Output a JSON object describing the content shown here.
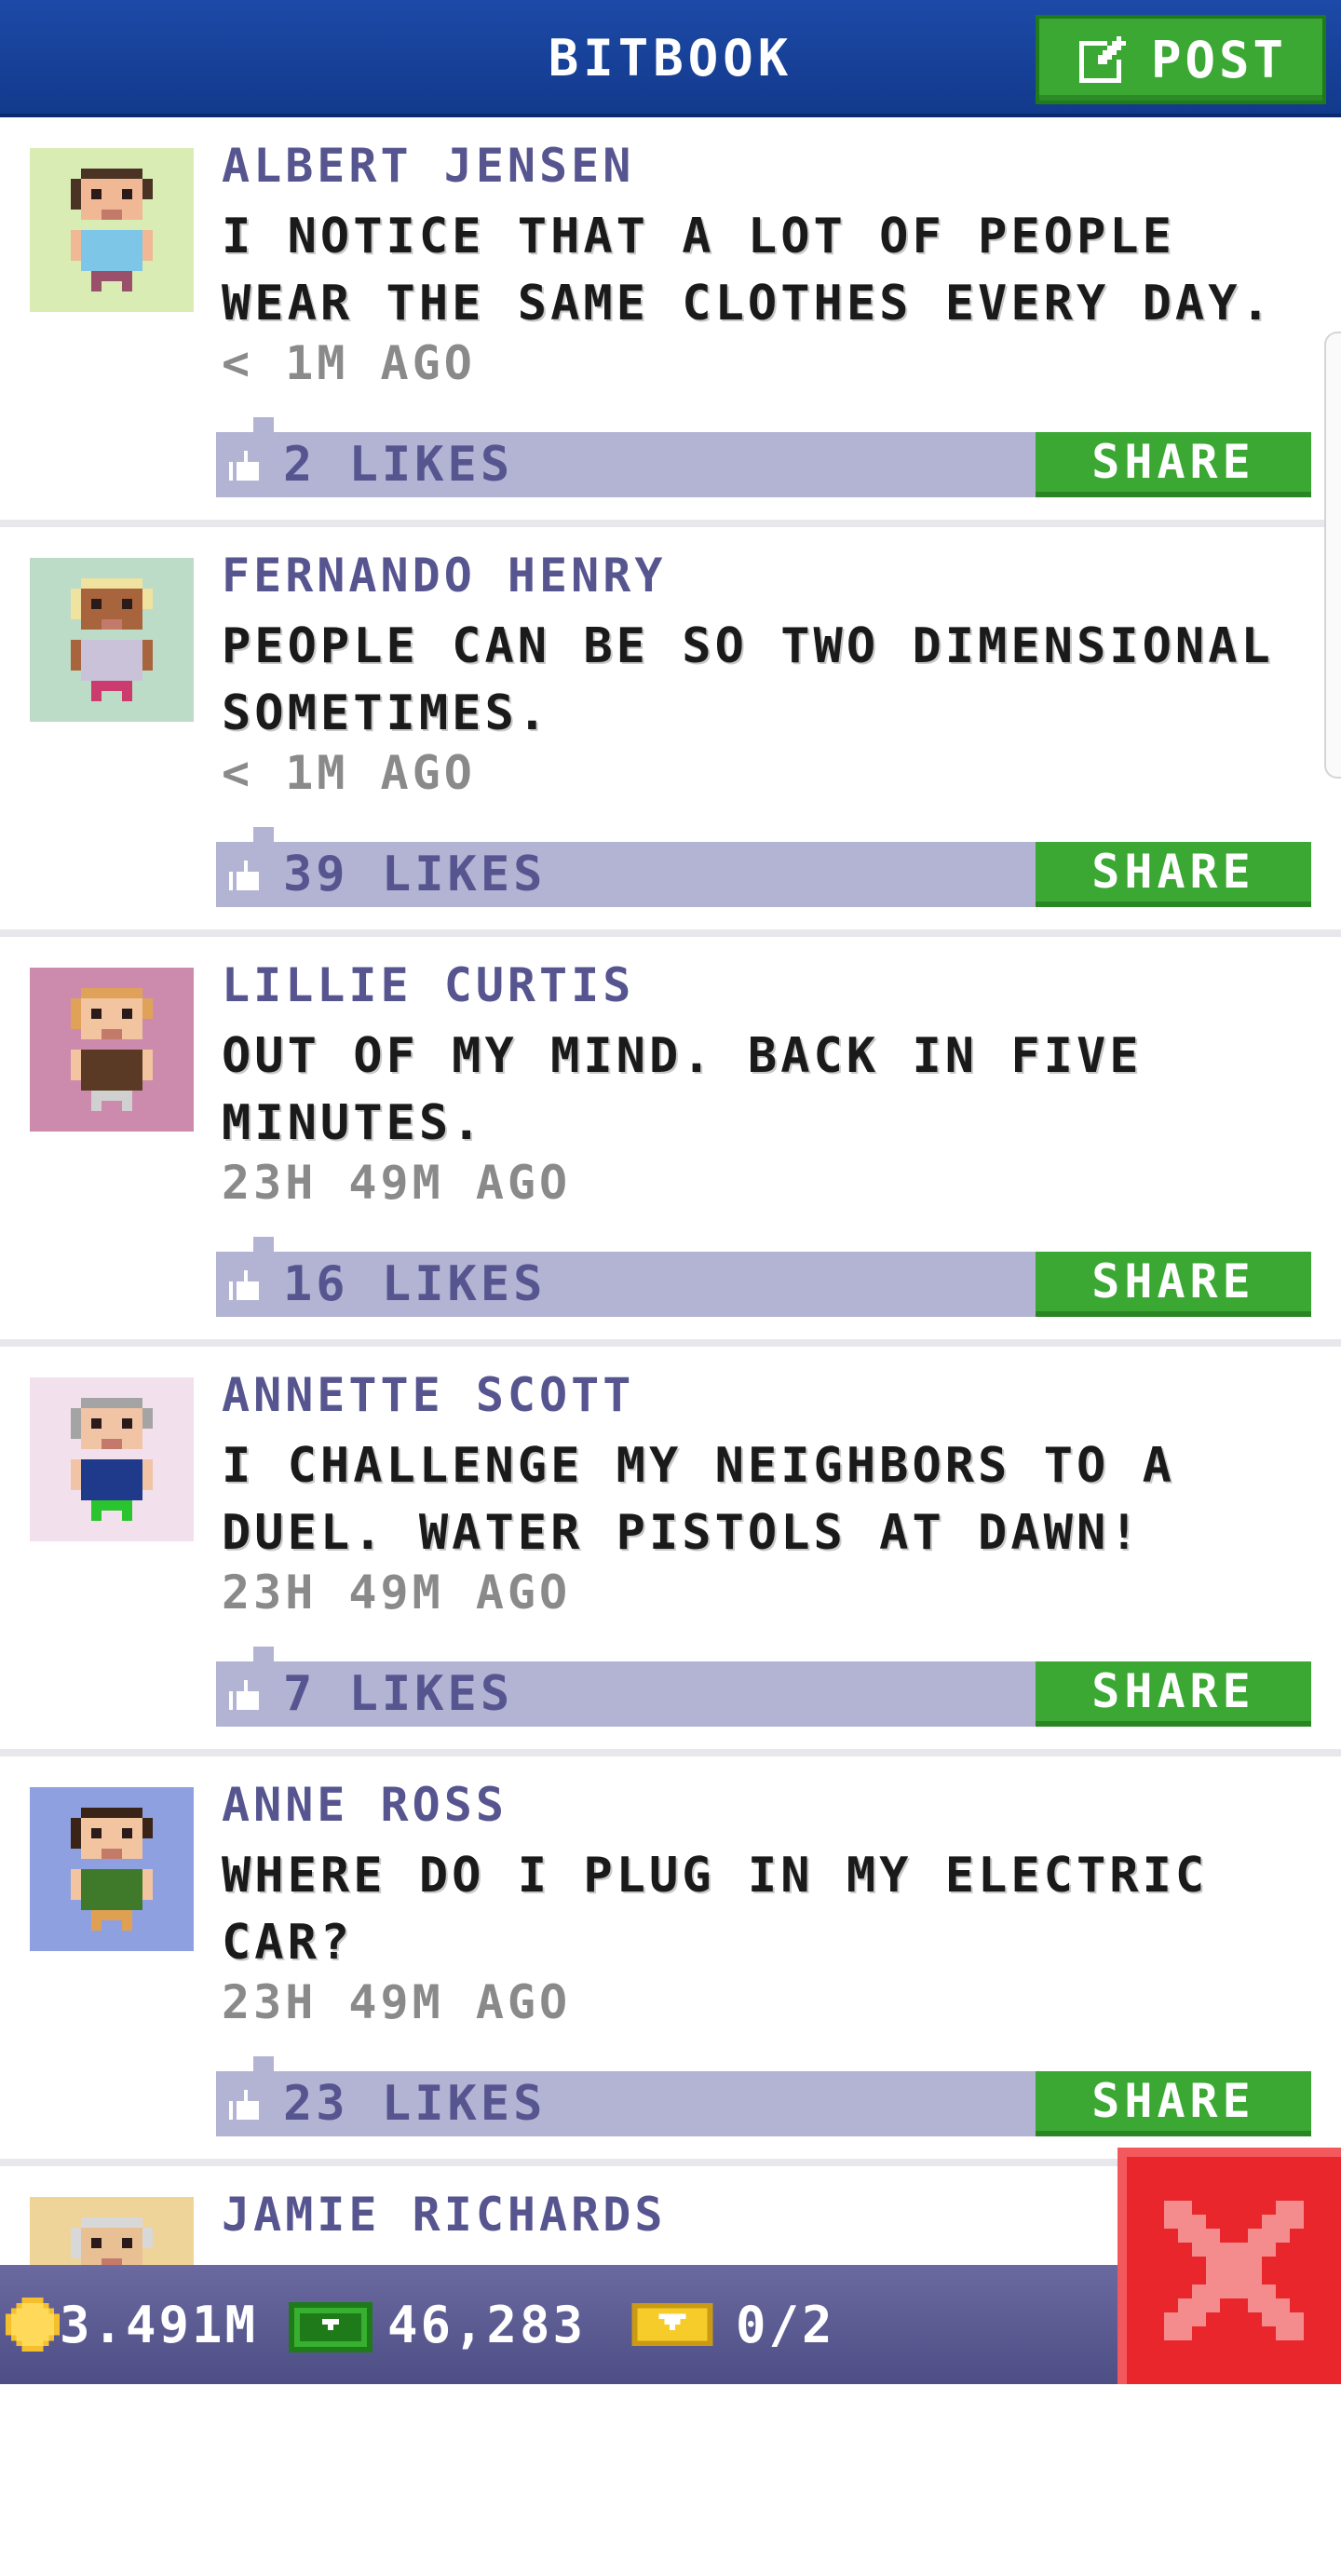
{
  "header": {
    "title": "BITBOOK",
    "post_label": "POST"
  },
  "posts": [
    {
      "author": "ALBERT JENSEN",
      "content": "I NOTICE THAT A LOT OF PEOPLE WEAR THE SAME CLOTHES EVERY DAY.",
      "time": "< 1M AGO",
      "likes": "2 LIKES",
      "share": "SHARE"
    },
    {
      "author": "FERNANDO HENRY",
      "content": "PEOPLE CAN BE SO TWO DIMENSIONAL SOMETIMES.",
      "time": "< 1M AGO",
      "likes": "39 LIKES",
      "share": "SHARE"
    },
    {
      "author": "LILLIE CURTIS",
      "content": "OUT OF MY MIND. BACK IN FIVE MINUTES.",
      "time": "23H 49M AGO",
      "likes": "16 LIKES",
      "share": "SHARE"
    },
    {
      "author": "ANNETTE SCOTT",
      "content": "I CHALLENGE MY NEIGHBORS TO A DUEL. WATER PISTOLS AT DAWN!",
      "time": "23H 49M AGO",
      "likes": "7 LIKES",
      "share": "SHARE"
    },
    {
      "author": "ANNE ROSS",
      "content": "WHERE DO I PLUG IN MY ELECTRIC CAR?",
      "time": "23H 49M AGO",
      "likes": "23 LIKES",
      "share": "SHARE"
    },
    {
      "author": "JAMIE RICHARDS"
    }
  ],
  "avatars": [
    {
      "bg": "#d9ecb4",
      "skin": "#f0b894",
      "hair": "#4a3324",
      "shirt": "#7ec6e8",
      "pants": "#9a4f6a",
      "icon": "bitizen-avatar"
    },
    {
      "bg": "#bcdcc8",
      "skin": "#a8643c",
      "hair": "#f0e3a0",
      "shirt": "#c9c2d8",
      "pants": "#cc3b6e",
      "icon": "bitizen-avatar"
    },
    {
      "bg": "#cc8aac",
      "skin": "#f2c4a0",
      "hair": "#e0a258",
      "shirt": "#5a3a24",
      "pants": "#d0d0d0",
      "icon": "bitizen-avatar"
    },
    {
      "bg": "#f2e1ec",
      "skin": "#f0c4a4",
      "hair": "#a4a4a4",
      "shirt": "#1f3a8a",
      "pants": "#2ac42e",
      "icon": "bitizen-avatar"
    },
    {
      "bg": "#8fa0e0",
      "skin": "#f2c4a0",
      "hair": "#3a2418",
      "shirt": "#3f7a2a",
      "pants": "#e0a054",
      "icon": "bitizen-avatar"
    },
    {
      "bg": "#efd49a",
      "skin": "#e8c094",
      "hair": "#d8d8d8",
      "shirt": "#c9c2d8",
      "pants": "#cc3b6e",
      "icon": "bitizen-avatar"
    }
  ],
  "status": {
    "coins": "3.491M",
    "bux": "46,283",
    "tickets": "0/2"
  },
  "colors": {
    "header": "#1d4aa8",
    "button_green": "#3aa833",
    "likes_bar": "#b3b3d4",
    "name_purple": "#57558f",
    "close_red": "#e8262b"
  }
}
